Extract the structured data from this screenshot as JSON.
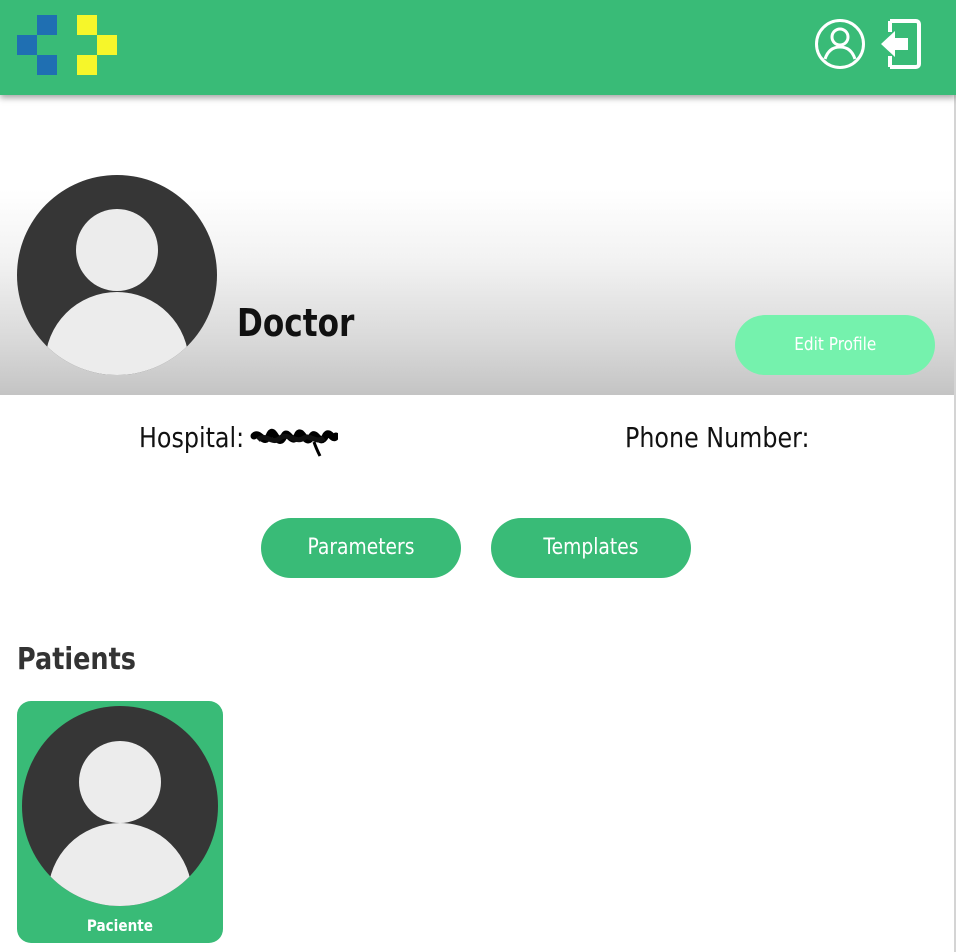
{
  "header": {
    "logo_icon": "cross-pixel-logo-icon",
    "colors": {
      "bar": "#39bb77",
      "logo_blue": "#1f6fb2",
      "logo_yellow": "#f6f62a"
    },
    "profile_icon": "user-circle-icon",
    "logout_icon": "logout-door-icon"
  },
  "profile": {
    "avatar_icon": "default-avatar-icon",
    "name": "Doctor",
    "edit_button_label": "Edit Profile",
    "hospital_label": "Hospital:",
    "phone_label": "Phone Number:"
  },
  "actions": {
    "parameters_label": "Parameters",
    "templates_label": "Templates",
    "accent": "#39bb77"
  },
  "patients": {
    "title": "Patients",
    "items": [
      {
        "name": "Paciente",
        "avatar_icon": "default-avatar-icon"
      }
    ]
  }
}
